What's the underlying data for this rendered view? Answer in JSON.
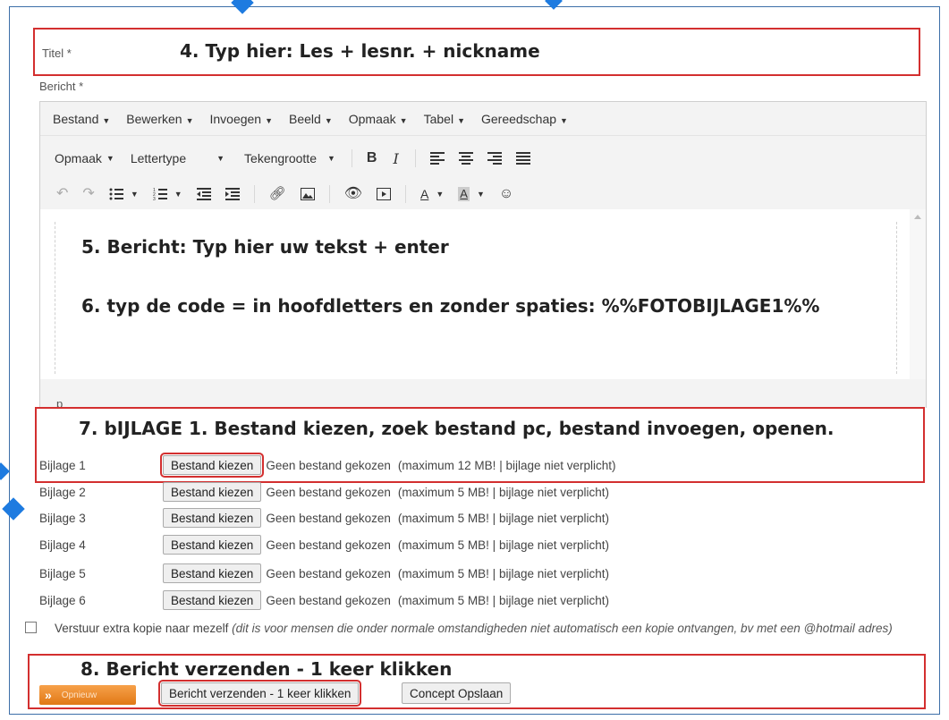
{
  "titel": {
    "label": "Titel *",
    "annotation": "4. Typ hier: Les + lesnr. + nickname"
  },
  "bericht": {
    "label": "Bericht *"
  },
  "editor": {
    "menu": [
      {
        "label": "Bestand"
      },
      {
        "label": "Bewerken"
      },
      {
        "label": "Invoegen"
      },
      {
        "label": "Beeld"
      },
      {
        "label": "Opmaak"
      },
      {
        "label": "Tabel"
      },
      {
        "label": "Gereedschap"
      }
    ],
    "format_label": "Opmaak",
    "font_label": "Lettertype",
    "size_label": "Tekengrootte",
    "bold_glyph": "B",
    "italic_glyph": "I",
    "path": "p",
    "content_line1": "5. Bericht: Typ hier uw tekst + enter",
    "content_line2": "6. typ de code = in hoofdletters en zonder spaties:  %%FOTOBIJLAGE1%%"
  },
  "annotation_bijlage": "7. bIJLAGE 1. Bestand kiezen, zoek bestand pc, bestand invoegen, openen.",
  "bijlagen": [
    {
      "label": "Bijlage 1",
      "button": "Bestand kiezen",
      "status": "Geen bestand gekozen",
      "note": "(maximum 12 MB! | bijlage niet verplicht)"
    },
    {
      "label": "Bijlage 2",
      "button": "Bestand kiezen",
      "status": "Geen bestand gekozen",
      "note": "(maximum 5 MB! | bijlage niet verplicht)"
    },
    {
      "label": "Bijlage 3",
      "button": "Bestand kiezen",
      "status": "Geen bestand gekozen",
      "note": "(maximum 5 MB! | bijlage niet verplicht)"
    },
    {
      "label": "Bijlage 4",
      "button": "Bestand kiezen",
      "status": "Geen bestand gekozen",
      "note": "(maximum 5 MB! | bijlage niet verplicht)"
    },
    {
      "label": "Bijlage 5",
      "button": "Bestand kiezen",
      "status": "Geen bestand gekozen",
      "note": "(maximum 5 MB! | bijlage niet verplicht)"
    },
    {
      "label": "Bijlage 6",
      "button": "Bestand kiezen",
      "status": "Geen bestand gekozen",
      "note": "(maximum 5 MB! | bijlage niet verplicht)"
    }
  ],
  "kopie": {
    "label": "Verstuur extra kopie naar mezelf",
    "note": "(dit is voor mensen die onder normale omstandigheden niet automatisch een kopie ontvangen, bv met een @hotmail adres)"
  },
  "annotation_verzenden": "8. Bericht verzenden - 1 keer klikken",
  "buttons": {
    "opnieuw": "Opnieuw",
    "verzenden": "Bericht verzenden - 1 keer klikken",
    "concept": "Concept Opslaan"
  },
  "colors": {
    "frame": "#3d6fa8",
    "highlight": "#d32f2f",
    "accent": "#e07815"
  }
}
